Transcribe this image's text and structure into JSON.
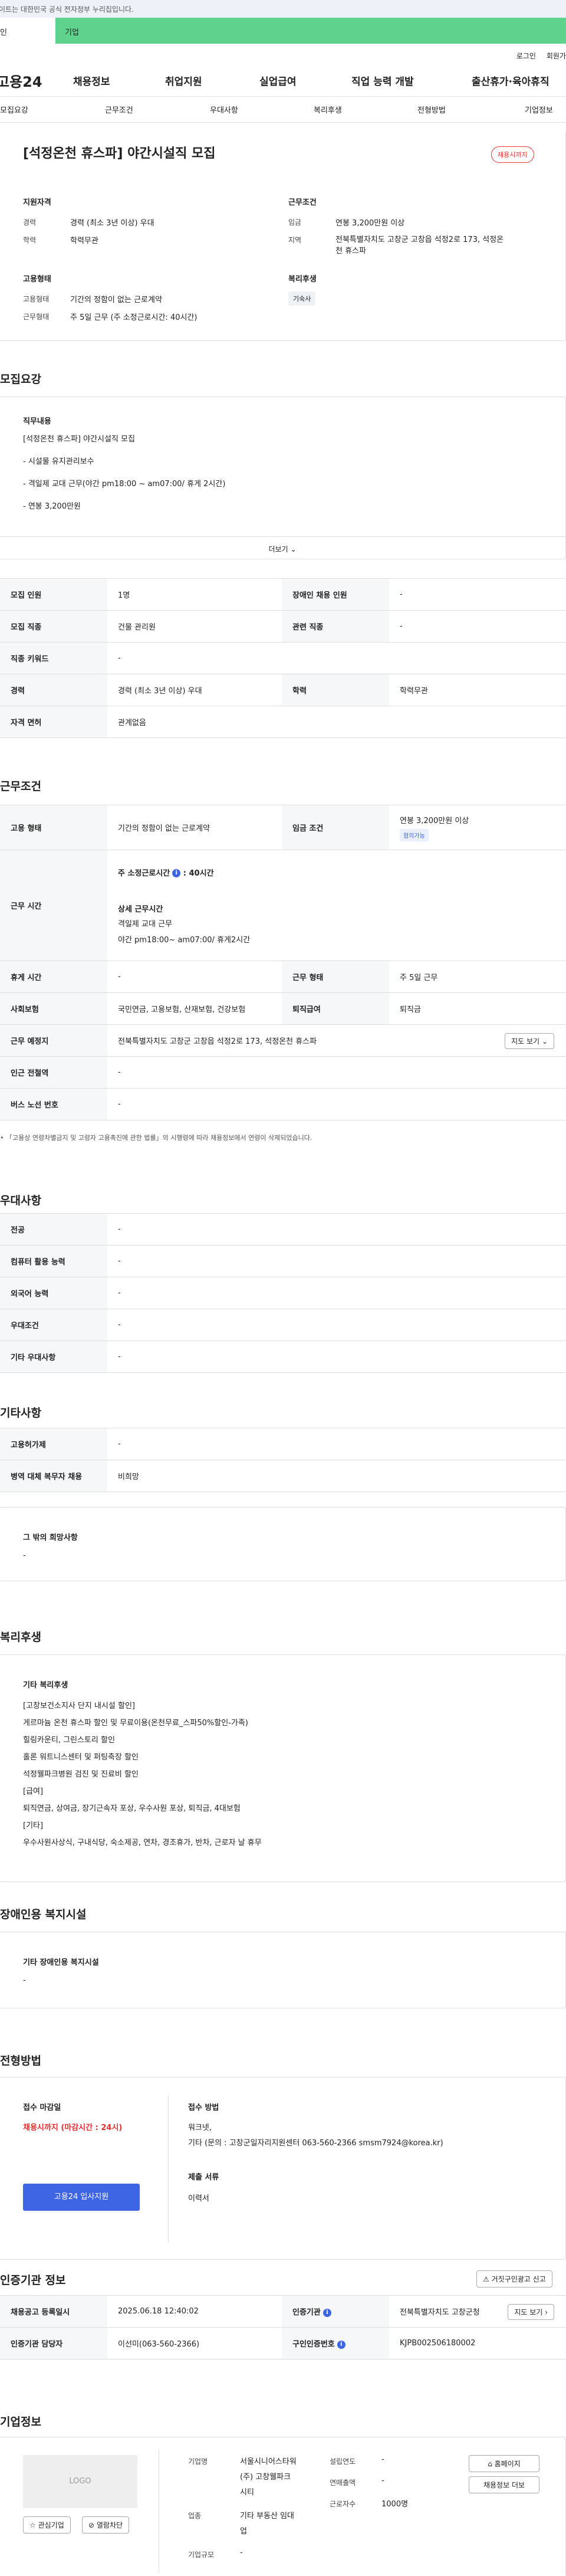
{
  "gov_bar": {
    "text": "이트는 대한민국 공식 전자정부 누리집입니다."
  },
  "top_tabs": {
    "person": "인",
    "corp": "기업"
  },
  "util": {
    "login": "로그인",
    "join": "회원가"
  },
  "gnb": {
    "logo": "고용24",
    "items": [
      "채용정보",
      "취업지원",
      "실업급여",
      "직업 능력 개발",
      "출산휴가·육아휴직"
    ]
  },
  "lnb": {
    "items": [
      "모집요강",
      "근무조건",
      "우대사항",
      "복리후생",
      "전형방법",
      "기업정보"
    ]
  },
  "summary": {
    "title": "[석정온천 휴스파] 야간시설직 모집",
    "badge": "채용시까지",
    "qual_title": "지원자격",
    "career_label": "경력",
    "career_value": "경력 (최소 3년 이상) 우대",
    "edu_label": "학력",
    "edu_value": "학력무관",
    "cond_title": "근무조건",
    "wage_label": "임금",
    "wage_value": "연봉 3,200만원 이상",
    "region_label": "지역",
    "region_value": "전북특별자치도 고창군 고창읍 석정2로 173, 석정온천 휴스파",
    "emp_title": "고용형태",
    "emp_label": "고용형태",
    "emp_value": "기간의 정함이 없는 근로계약",
    "work_label": "근무형태",
    "work_value": "주 5일 근무 (주 소정근로시간: 40시간)",
    "welfare_title": "복리후생",
    "welfare_chip": "기숙사"
  },
  "recruit": {
    "section_title": "모집요강",
    "duty_title": "직무내용",
    "duty_lines": [
      "[석정온천 휴스파] 야간시설직 모집",
      "",
      "- 시설물 유지관리보수",
      "",
      "- 격일제 교대 근무(야간 pm18:00 ~ am07:00/ 휴게 2시간)",
      "",
      "- 연봉 3,200만원"
    ],
    "more": "더보기",
    "rows": [
      {
        "l1": "모집 인원",
        "v1": "1명",
        "l2": "장애인 채용 인원",
        "v2": "-"
      },
      {
        "l1": "모집 직종",
        "v1": "건물 관리원",
        "l2": "관련 직종",
        "v2": "-"
      },
      {
        "l1": "직종 키워드",
        "v1": "-"
      },
      {
        "l1": "경력",
        "v1": "경력 (최소 3년 이상) 우대",
        "l2": "학력",
        "v2": "학력무관"
      },
      {
        "l1": "자격 면허",
        "v1": "관계없음"
      }
    ]
  },
  "conditions": {
    "section_title": "근무조건",
    "emp_label": "고용 형태",
    "emp_value": "기간의 정함이 없는 근로계약",
    "wage_label": "임금 조건",
    "wage_value": "연봉 3,200만원 이상",
    "wage_chip": "협의가능",
    "hours_label": "근무 시간",
    "hours_title": "주 소정근로시간",
    "hours_value": "40시간",
    "detail_title": "상세 근무시간",
    "detail_1": "격일제 교대 근무",
    "detail_2": "야간 pm18:00~ am07:00/ 휴게2시간",
    "rest_label": "휴게 시간",
    "rest_value": "-",
    "work_label": "근무 형태",
    "work_value": "주 5일 근무",
    "ins_label": "사회보험",
    "ins_value": "국민연금, 고용보험, 산재보험, 건강보험",
    "retire_label": "퇴직급여",
    "retire_value": "퇴직금",
    "place_label": "근무 예정지",
    "place_value": "전북특별자치도 고창군 고창읍 석정2로 173, 석정온천 휴스파",
    "map_btn": "지도 보기",
    "subway_label": "인근 전철역",
    "subway_value": "-",
    "bus_label": "버스 노선 번호",
    "bus_value": "-",
    "note": "「고용상 연령차별금지 및 고령자 고용촉진에 관한 법률」의 시행령에 따라 채용정보에서 연령이 삭제되었습니다."
  },
  "preference": {
    "section_title": "우대사항",
    "rows": [
      {
        "l": "전공",
        "v": "-"
      },
      {
        "l": "컴퓨터 활용 능력",
        "v": "-"
      },
      {
        "l": "외국어 능력",
        "v": "-"
      },
      {
        "l": "우대조건",
        "v": "-"
      },
      {
        "l": "기타 우대사항",
        "v": "-"
      }
    ]
  },
  "etc": {
    "section_title": "기타사항",
    "rows": [
      {
        "l": "고용허가제",
        "v": "-"
      },
      {
        "l": "병역 대체 복무자 채용",
        "v": "비희망"
      }
    ],
    "wish_title": "그 밖의 희망사항",
    "wish_value": "-"
  },
  "welfare": {
    "section_title": "복리후생",
    "box_title": "기타 복리후생",
    "lines": [
      "[고창보건소지사 단지 내시설 할인]",
      "게르마늄 온천 휴스파 할인 및 무료이용(온천무료_스파50%할인-가족)",
      "힐링카운티, 그린스토리 할인",
      "홀론 워트니스센터 및 퍼팅축장 할인",
      "석정웰파크병원 검진 및 진료비 할인",
      "[급여]",
      "퇴직연금, 상여금, 장기근속자 포상, 우수사원 포상, 퇴직금, 4대보험",
      "[기타]",
      "우수사원사상식, 구내식당, 숙소제공, 연차, 경조휴가, 반차, 근로자 날 휴무"
    ]
  },
  "disability": {
    "section_title": "장애인용 복지시설",
    "box_title": "기타 장애인용 복지시설",
    "box_value": "-"
  },
  "apply": {
    "section_title": "전형방법",
    "deadline_title": "접수 마감일",
    "deadline_value": "채용시까지 (마감시간 : 24시)",
    "apply_btn": "고용24 입사지원",
    "method_title": "접수 방법",
    "method_1": "워크넷,",
    "method_2": "기타 (문의 : 고창군일자리지원센터 063-560-2366  smsm7924@korea.kr)",
    "docs_title": "제출 서류",
    "docs_value": "이력서"
  },
  "cert": {
    "section_title": "인증기관 정보",
    "report_btn": "거짓구인광고 신고",
    "reg_label": "채용공고 등록일시",
    "reg_value": "2025.06.18 12:40:02",
    "org_label": "인증기관",
    "org_value": "전북특별자치도 고창군청",
    "map_btn": "지도 보기",
    "manager_label": "인증기관 담당자",
    "manager_value": "이선미(063-560-2366)",
    "num_label": "구인인증번호",
    "num_value": "KJPB002506180002"
  },
  "company": {
    "section_title": "기업정보",
    "logo": "LOGO",
    "fav_btn": "관심기업",
    "block_btn": "열람차단",
    "name_label": "기업명",
    "name_value_1": "서울시니어스타워",
    "name_value_2": "(주) 고창웰파크",
    "name_value_3": "시티",
    "ind_label": "업종",
    "ind_value_1": "기타 부동산 임대",
    "ind_value_2": "업",
    "scale_label": "기업규모",
    "scale_value": "-",
    "year_label": "설립연도",
    "year_value": "-",
    "sales_label": "연매출액",
    "sales_value": "-",
    "emp_label": "근로자수",
    "emp_value": "1000명",
    "home_btn": "홈페이지",
    "list_btn": "채용정보 더보"
  }
}
